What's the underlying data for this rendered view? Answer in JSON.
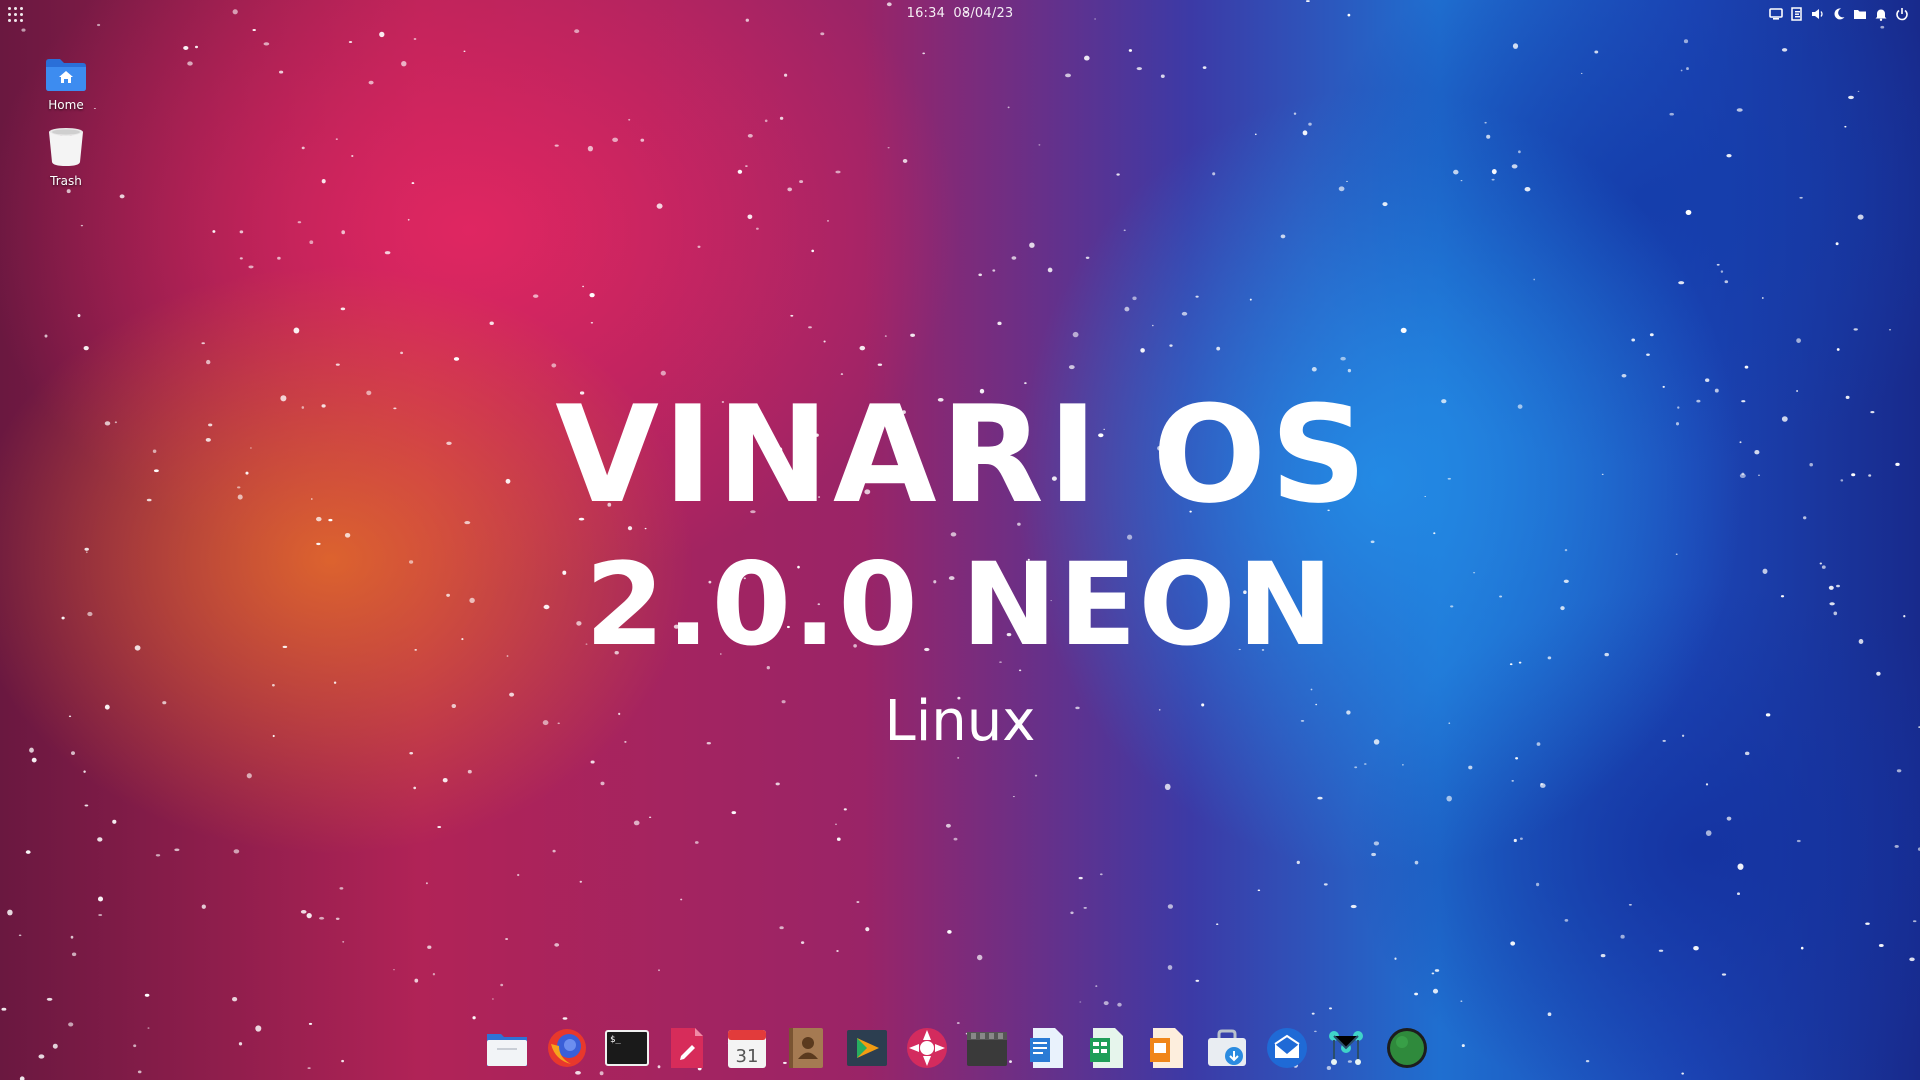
{
  "topbar": {
    "clock_time": "16:34",
    "clock_date": "08/04/23",
    "tray_icons": [
      "display-icon",
      "keyboard-layout-icon",
      "volume-icon",
      "night-mode-icon",
      "folder-icon",
      "notification-bell-icon",
      "power-icon"
    ]
  },
  "desktop_icons": {
    "home_label": "Home",
    "trash_label": "Trash"
  },
  "center_title": {
    "line1": "VINARI OS",
    "line2": "2.0.0 NEON",
    "line3": "Linux"
  },
  "dock": {
    "apps": [
      "files-icon",
      "firefox-icon",
      "terminal-icon",
      "text-editor-icon",
      "calendar-icon",
      "contacts-icon",
      "code-editor-icon",
      "media-player-icon",
      "video-editor-icon",
      "writer-icon",
      "spreadsheet-icon",
      "presentation-icon",
      "software-center-icon",
      "mail-icon",
      "settings-nodes-icon",
      "globe-icon"
    ],
    "calendar_day": "31"
  },
  "colors": {
    "wallpaper_pink": "#e2265f",
    "wallpaper_orange": "#e66e28",
    "wallpaper_blue": "#238ce6",
    "wallpaper_deep_blue": "#182a8c"
  }
}
